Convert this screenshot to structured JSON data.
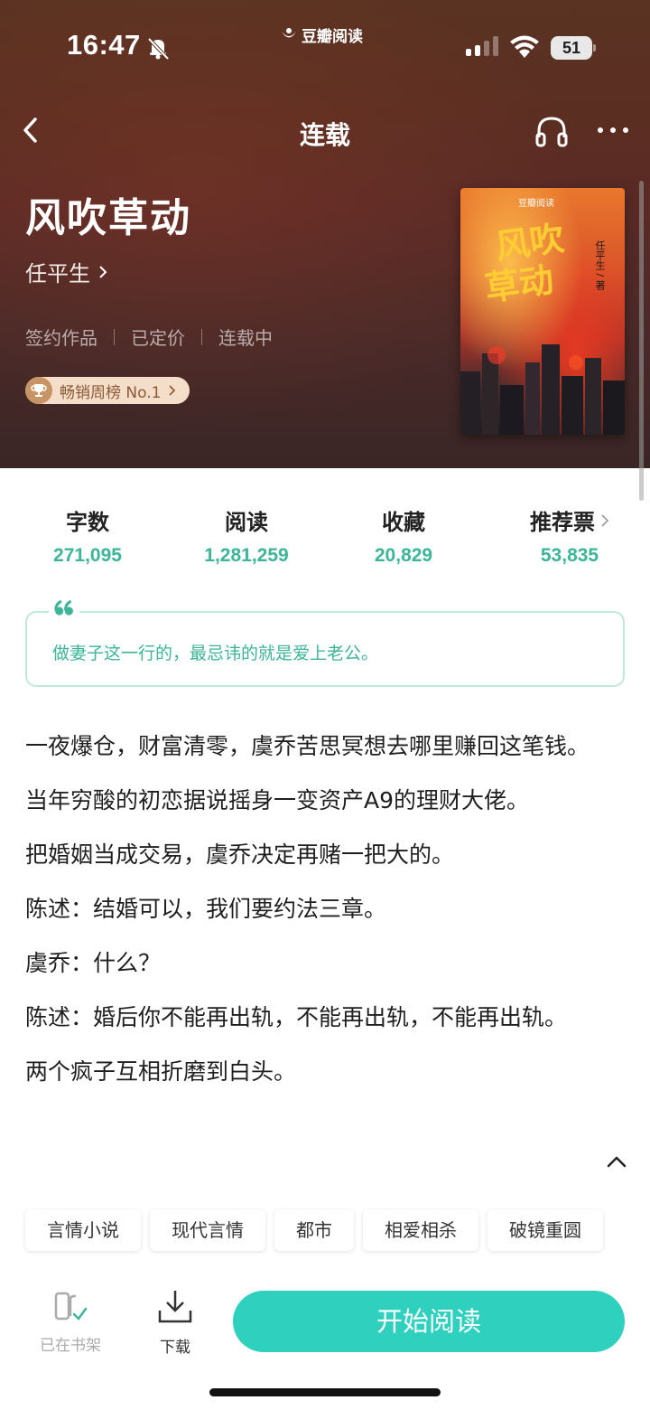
{
  "status_bar": {
    "time": "16:47",
    "app_source": "豆瓣阅读",
    "battery": "51"
  },
  "nav": {
    "title": "连载"
  },
  "book": {
    "title": "风吹草动",
    "author": "任平生",
    "meta": [
      "签约作品",
      "已定价",
      "连载中"
    ],
    "rank": "畅销周榜 No.1",
    "cover": {
      "logo": "豆瓣阅读",
      "title_line1": "风吹",
      "title_line2": "草动",
      "author": "任平生 / 著"
    }
  },
  "stats": [
    {
      "label": "字数",
      "value": "271,095"
    },
    {
      "label": "阅读",
      "value": "1,281,259"
    },
    {
      "label": "收藏",
      "value": "20,829"
    },
    {
      "label": "推荐票",
      "value": "53,835"
    }
  ],
  "quote": "做妻子这一行的，最忌讳的就是爱上老公。",
  "description": [
    "一夜爆仓，财富清零，虞乔苦思冥想去哪里赚回这笔钱。",
    "当年穷酸的初恋据说摇身一变资产A9的理财大佬。",
    "把婚姻当成交易，虞乔决定再赌一把大的。",
    "陈述：结婚可以，我们要约法三章。",
    "虞乔：什么？",
    "陈述：婚后你不能再出轨，不能再出轨，不能再出轨。",
    "两个疯子互相折磨到白头。"
  ],
  "tags": [
    "言情小说",
    "现代言情",
    "都市",
    "相爱相杀",
    "破镜重圆"
  ],
  "bottom": {
    "shelf_label": "已在书架",
    "download_label": "下载",
    "start_label": "开始阅读"
  },
  "colors": {
    "accent": "#3cb599",
    "button": "#2fd0bd",
    "hero": "#5a2a26"
  }
}
